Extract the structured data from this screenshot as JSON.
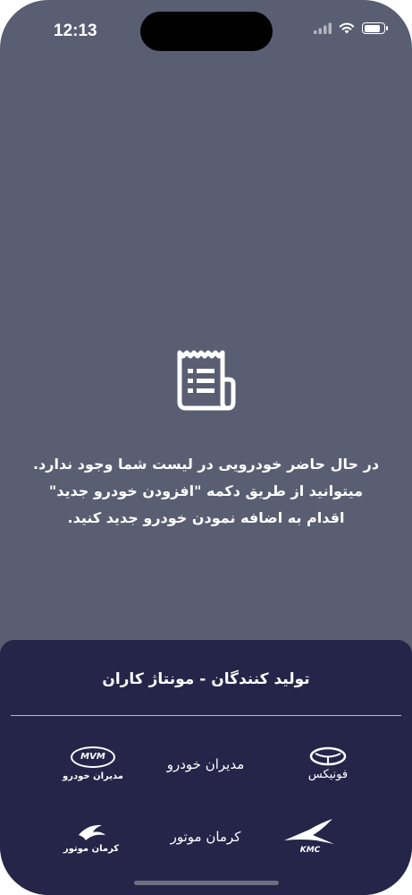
{
  "status_bar": {
    "time": "12:13",
    "icons": [
      "signal-icon",
      "wifi-icon",
      "battery-icon"
    ],
    "battery_level": 0.85
  },
  "empty_state": {
    "icon": "receipt-icon",
    "message": "در حال حاضر خودرویی در لیست شما وجود ندارد. میتوانید از طریق دکمه \"افزودن خودرو جدید\" اقدام به اضافه نمودن خودرو جدید کنید."
  },
  "sheet": {
    "title": "تولید کنندگان - مونتاژ کاران",
    "brands": [
      {
        "name": "fownix",
        "logo_text": "فونیکس",
        "kind": "logo"
      },
      {
        "name": "modiran-khodro-text",
        "label": "مدیران خودرو",
        "kind": "text"
      },
      {
        "name": "mvm",
        "logo_text": "MVM",
        "logo_subtext": "مدیران خودرو",
        "kind": "logo"
      },
      {
        "name": "kmc",
        "logo_text": "KMC",
        "kind": "logo"
      },
      {
        "name": "kerman-motor-text",
        "label": "کرمان موتور",
        "kind": "text"
      },
      {
        "name": "kerman-motor-logo",
        "logo_text": "کرمان موتور",
        "kind": "logo"
      }
    ]
  },
  "colors": {
    "background": "#5a5e72",
    "sheet": "#25254a",
    "text": "#ffffff",
    "icon": "#ffffff"
  }
}
